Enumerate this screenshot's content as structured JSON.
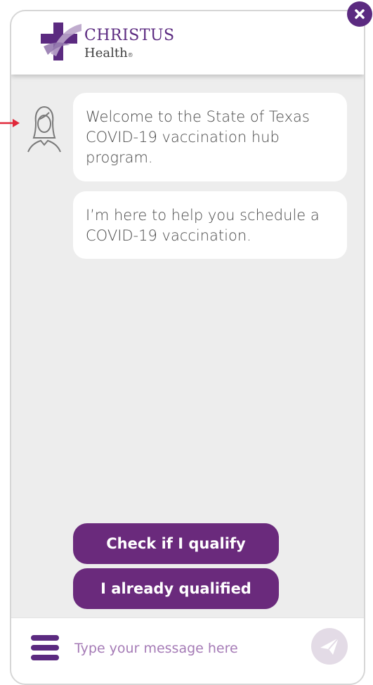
{
  "header": {
    "logo_name": "CHRISTUS",
    "logo_sub": "Health",
    "logo_mark": "®"
  },
  "close_icon": "close-icon",
  "messages": [
    {
      "text": "Welcome to the State of Texas COVID-19 vaccination hub program."
    },
    {
      "text": "I’m here to help you schedule a COVID-19 vaccination."
    }
  ],
  "quick_replies": [
    {
      "label": "Check if I qualify"
    },
    {
      "label": "I already qualified"
    }
  ],
  "composer": {
    "placeholder": "Type your message here"
  },
  "colors": {
    "brand": "#5b2a80",
    "button": "#6a2a7c",
    "panel": "#ededed",
    "pointer": "#e0283a"
  }
}
